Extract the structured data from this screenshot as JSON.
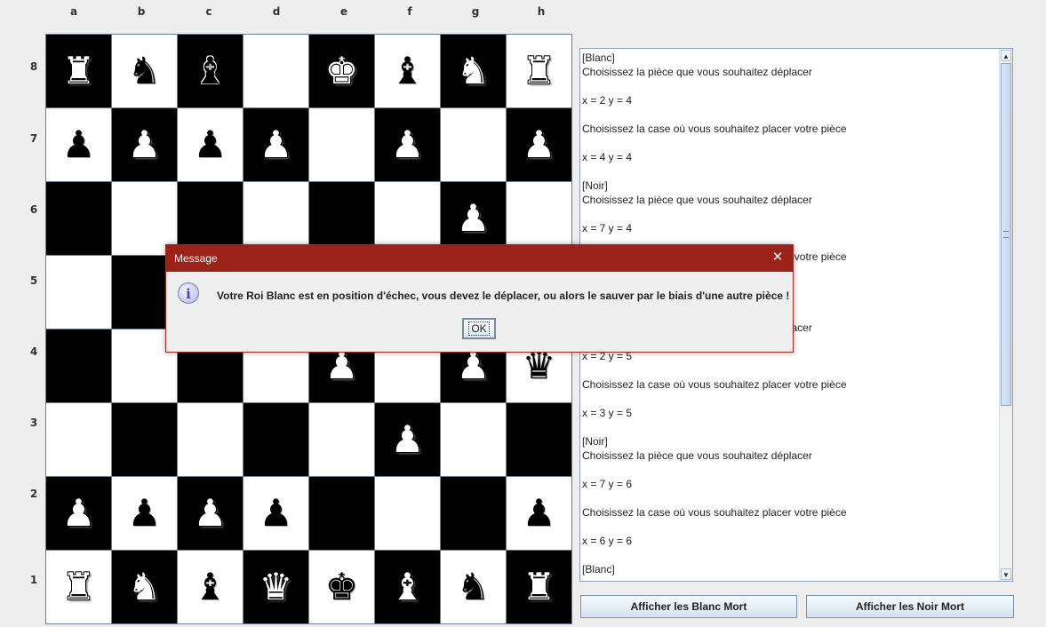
{
  "files": [
    "a",
    "b",
    "c",
    "d",
    "e",
    "f",
    "g",
    "h"
  ],
  "ranks": [
    "8",
    "7",
    "6",
    "5",
    "4",
    "3",
    "2",
    "1"
  ],
  "board": [
    [
      "wR",
      "bN",
      "bB",
      "",
      "wK",
      "bB",
      "wN",
      "wR"
    ],
    [
      "bP",
      "wP",
      "bP",
      "wP",
      "",
      "wP",
      "",
      "wP"
    ],
    [
      "",
      "",
      "",
      "",
      "",
      "",
      "wP",
      ""
    ],
    [
      "",
      "",
      "",
      "",
      "",
      "",
      "",
      ""
    ],
    [
      "",
      "",
      "",
      "",
      "wP",
      "",
      "wP",
      "bQ"
    ],
    [
      "",
      "",
      "",
      "",
      "",
      "wP",
      "",
      ""
    ],
    [
      "wP",
      "bP",
      "wP",
      "bP",
      "",
      "",
      "",
      "bP"
    ],
    [
      "wR",
      "wN",
      "bB",
      "wQ",
      "bK",
      "wB",
      "bN",
      "wR"
    ]
  ],
  "log": [
    "[Blanc]",
    "Choisissez la pièce que vous souhaitez déplacer",
    "",
    "x = 2 y = 4",
    "",
    "Choisissez la case où vous souhaitez placer votre pièce",
    "",
    "x = 4 y = 4",
    "",
    "[Noir]",
    "Choisissez la pièce que vous souhaitez déplacer",
    "",
    "x = 7 y = 4",
    "",
    "Choisissez la case où vous souhaitez placer votre pièce",
    "",
    "",
    "",
    "",
    "Choisissez la pièce que vous souhaitez déplacer",
    "",
    "x = 2 y = 5",
    "",
    "Choisissez la case où vous souhaitez placer votre pièce",
    "",
    "x = 3 y = 5",
    "",
    "[Noir]",
    "Choisissez la pièce que vous souhaitez déplacer",
    "",
    "x = 7 y = 6",
    "",
    "Choisissez la case où vous souhaitez placer votre pièce",
    "",
    "x = 6 y = 6",
    "",
    "[Blanc]",
    "Choisissez la pièce que vous souhaitez déplacer"
  ],
  "buttons": {
    "white_dead": "Afficher les Blanc Mort",
    "black_dead": "Afficher les Noir Mort"
  },
  "dialog": {
    "title": "Message",
    "close": "✕",
    "icon": "i",
    "message": "Votre Roi Blanc est en position d'échec, vous devez le déplacer, ou alors le sauver par le biais d'une autre pièce !",
    "ok": "OK"
  },
  "scrollbar": {
    "up": "▲",
    "down": "▼"
  }
}
